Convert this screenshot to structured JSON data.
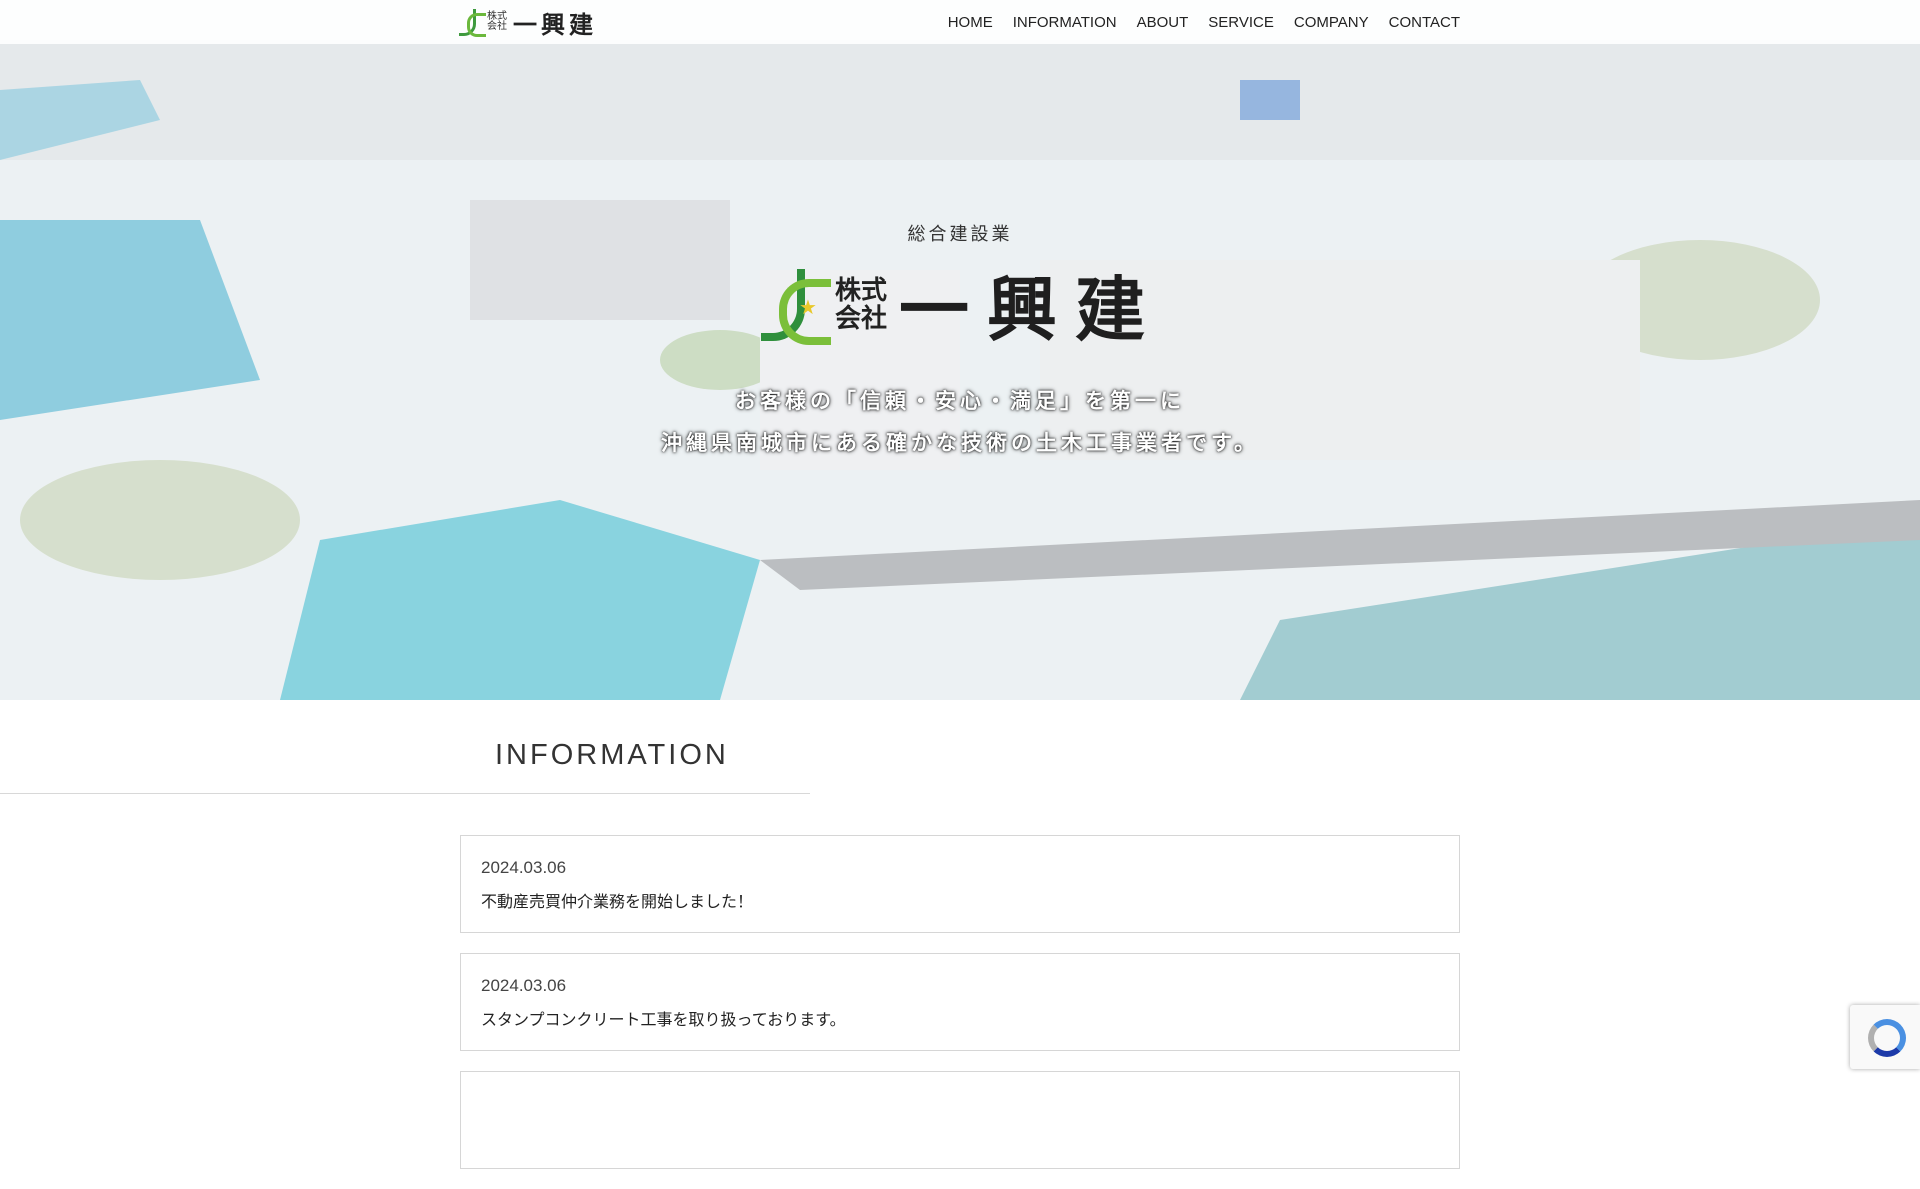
{
  "header": {
    "logo": {
      "kaisha": "株式会社",
      "name": "一興建"
    },
    "nav": [
      "HOME",
      "INFORMATION",
      "ABOUT",
      "SERVICE",
      "COMPANY",
      "CONTACT"
    ]
  },
  "hero": {
    "subtitle": "総合建設業",
    "logo_kaisha": "株式会社",
    "logo_name": "一興建",
    "line1": "お客様の「信頼・安心・満足」を第一に",
    "line2": "沖縄県南城市にある確かな技術の土木工事業者です。"
  },
  "information": {
    "heading": "INFORMATION",
    "items": [
      {
        "date": "2024.03.06",
        "title": "不動産売買仲介業務を開始しました！"
      },
      {
        "date": "2024.03.06",
        "title": "スタンプコンクリート工事を取り扱っております。"
      }
    ]
  },
  "colors": {
    "accent_green": "#3e9a3e",
    "sea_blue": "#35b3c9"
  }
}
